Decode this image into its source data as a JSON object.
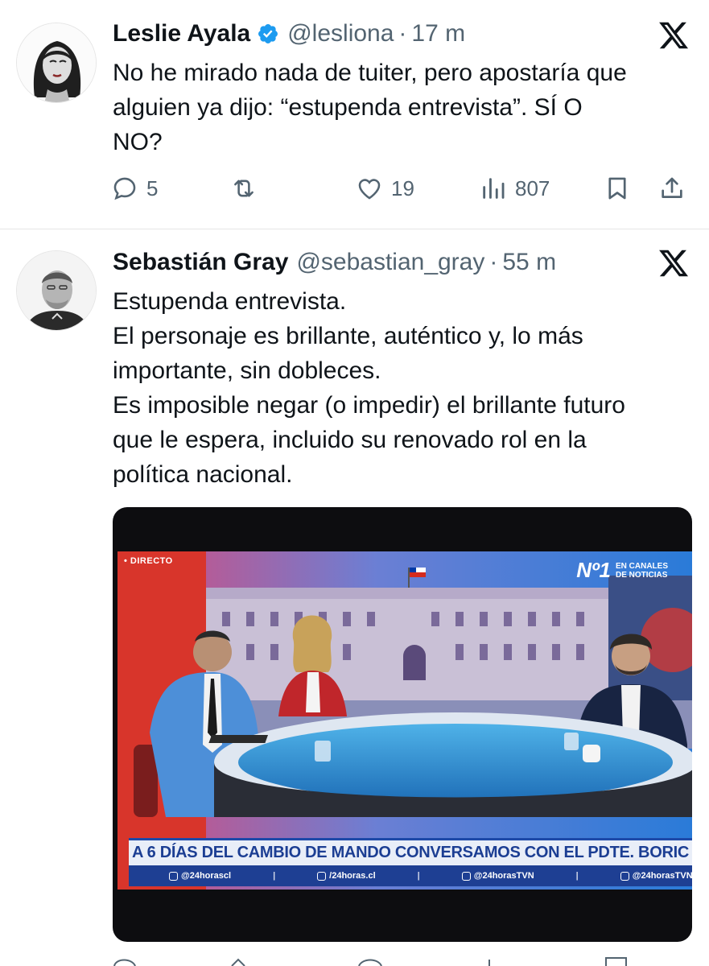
{
  "tweets": [
    {
      "display_name": "Leslie Ayala",
      "handle": "@lesliona",
      "separator": "·",
      "time": "17 m",
      "verified": true,
      "text_lines": [
        "No he mirado nada de tuiter, pero apostaría que",
        "alguien ya dijo: “estupenda entrevista”. SÍ O",
        "NO?"
      ],
      "replies": "5",
      "reposts": "",
      "likes": "19",
      "views": "807"
    },
    {
      "display_name": "Sebastián Gray",
      "handle": "@sebastian_gray",
      "separator": "·",
      "time": "55 m",
      "verified": false,
      "text_lines": [
        "Estupenda entrevista.",
        "El personaje es brillante, auténtico y, lo más",
        "importante, sin dobleces.",
        "Es imposible negar (o impedir) el brillante futuro",
        "que le espera, incluido su renovado rol en la",
        "política nacional."
      ],
      "media": {
        "live_label": "• DIRECTO",
        "channel_rank": "Nº1",
        "channel_rank_caption_1": "EN CANALES",
        "channel_rank_caption_2": "DE NOTICIAS",
        "headline": "A 6 DÍAS DEL CAMBIO DE MANDO CONVERSAMOS CON EL PDTE. BORIC",
        "social": [
          "@24horascl",
          "/24horas.cl",
          "@24horasTVN",
          "@24horasTVN"
        ]
      }
    }
  ],
  "icons": {
    "verified": "verified-badge-icon",
    "platform": "x-logo-icon",
    "reply": "reply-icon",
    "repost": "repost-icon",
    "like": "heart-icon",
    "views": "views-icon",
    "bookmark": "bookmark-icon",
    "share": "share-icon"
  },
  "colors": {
    "text_primary": "#0f1419",
    "text_secondary": "#536471",
    "verified_blue": "#1d9bf0",
    "divider": "#e6e6e6",
    "lower_third_text": "#1c3e93"
  }
}
